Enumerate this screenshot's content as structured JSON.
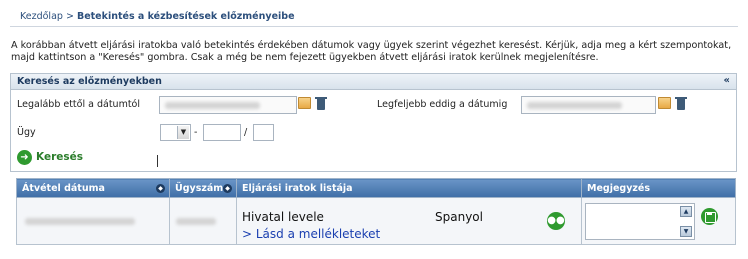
{
  "breadcrumb": {
    "home": "Kezdőlap",
    "separator": ">",
    "current": "Betekintés a kézbesítések előzményeibe"
  },
  "intro_text": "A korábban átvett eljárási iratokba való betekintés érdekében dátumok vagy ügyek szerint végezhet keresést. Kérjük, adja meg a kért szempontokat, majd kattintson a \"Keresés\" gombra. Csak a még be nem fejezett ügyekben átvett eljárási iratok kerülnek megjelenítésre.",
  "search_panel": {
    "title": "Keresés az előzményekben",
    "collapse_glyph": "«",
    "from_date_label": "Legalább ettől a dátumtól",
    "to_date_label": "Legfeljebb eddig a dátumig",
    "case_label": "Ügy",
    "case_dash": "-",
    "case_slash": "/",
    "search_button": "Keresés"
  },
  "results_table": {
    "columns": [
      "Átvétel dátuma",
      "Ügyszám",
      "Eljárási  iratok listája",
      "Megjegyzés"
    ],
    "rows": [
      {
        "document_name": "Hivatal levele",
        "language": "Spanyol",
        "attachments_link": "> Lásd a mellékleteket"
      }
    ]
  },
  "icons": {
    "date_picker": "calendar-icon",
    "clear": "trash-icon",
    "search": "arrow-right-circle-icon",
    "recipients": "people-icon",
    "save": "save-icon",
    "sort": "sort-icon"
  },
  "colors": {
    "header_blue": "#3f6ea6",
    "link_blue": "#1a3fb0",
    "action_green": "#2f9a2f",
    "breadcrumb": "#2c4f7c"
  }
}
